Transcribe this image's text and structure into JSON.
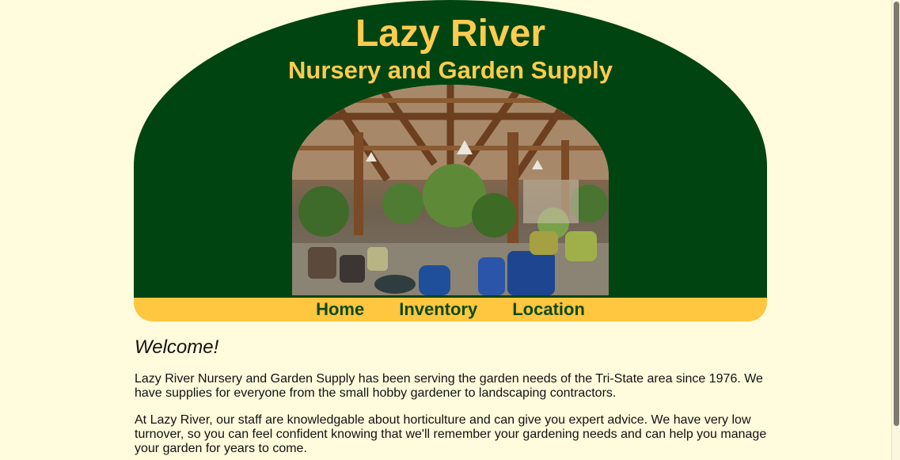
{
  "header": {
    "title": "Lazy River",
    "subtitle": "Nursery and Garden Supply"
  },
  "nav": {
    "items": [
      "Home",
      "Inventory",
      "Location"
    ]
  },
  "content": {
    "heading": "Welcome!",
    "paragraphs": [
      "Lazy River Nursery and Garden Supply has been serving the garden needs of the Tri-State area since 1976. We have supplies for everyone from the small hobby gardener to landscaping contractors.",
      "At Lazy River, our staff are knowledgable about horticulture and can give you expert advice. We have very low turnover, so you can feel confident knowing that we'll remember your gardening needs and can help you manage your garden for years to come."
    ]
  },
  "colors": {
    "header_green": "#004411",
    "title_gold": "#ffcc4f",
    "nav_gold": "#ffc63f",
    "background": "#fffbdc"
  }
}
